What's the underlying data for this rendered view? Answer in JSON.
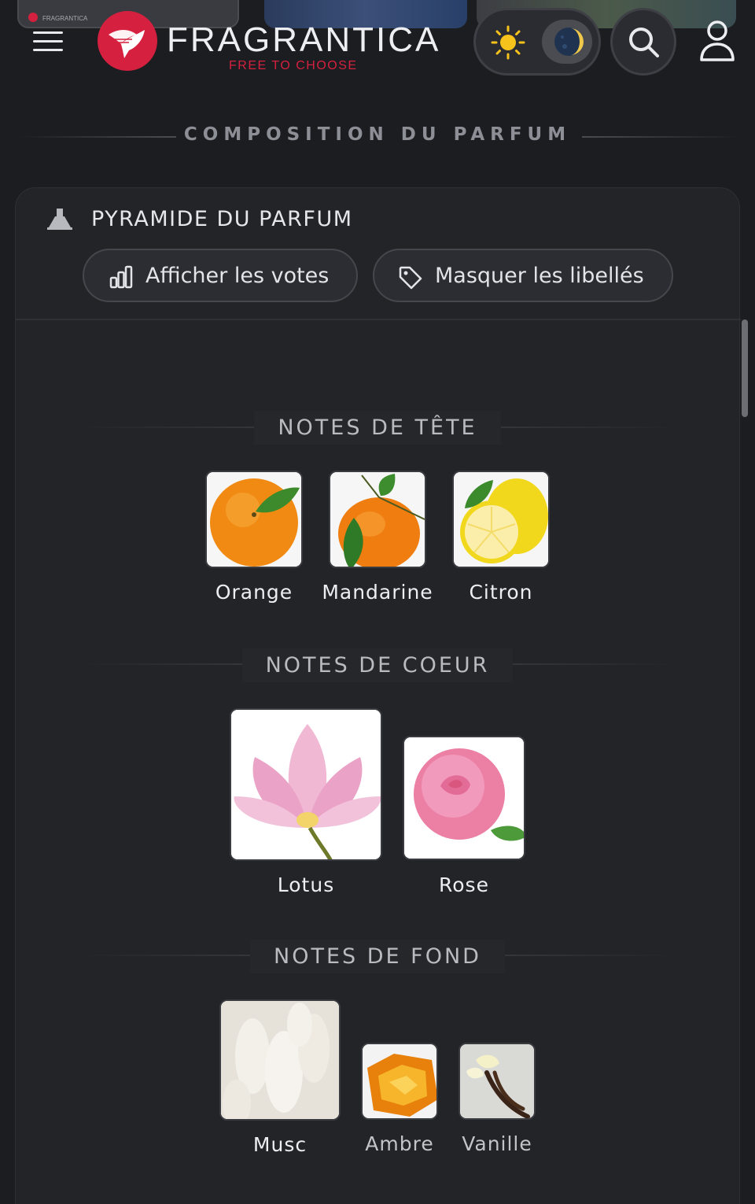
{
  "header": {
    "brand": "FRAGRANTICA",
    "tagline": "FREE TO CHOOSE",
    "top_strip_text": "FRAGRANTICA"
  },
  "section": {
    "title": "COMPOSITION DU PARFUM"
  },
  "card": {
    "title": "PYRAMIDE DU PARFUM",
    "votes_button": "Afficher les votes",
    "labels_button": "Masquer les libellés"
  },
  "groups": {
    "top": {
      "title": "NOTES DE TÊTE",
      "notes": [
        "Orange",
        "Mandarine",
        "Citron"
      ]
    },
    "heart": {
      "title": "NOTES DE COEUR",
      "notes": [
        "Lotus",
        "Rose"
      ]
    },
    "base": {
      "title": "NOTES DE FOND",
      "notes": [
        "Musc",
        "Ambre",
        "Vanille"
      ]
    }
  },
  "colors": {
    "background": "#1c1d21",
    "card": "#232428",
    "brand_red": "#d6203f"
  },
  "icons": [
    "menu-icon",
    "fragrantica-logo",
    "sun-icon",
    "moon-icon",
    "search-icon",
    "user-icon",
    "pyramid-icon",
    "bar-chart-icon",
    "tag-icon"
  ]
}
